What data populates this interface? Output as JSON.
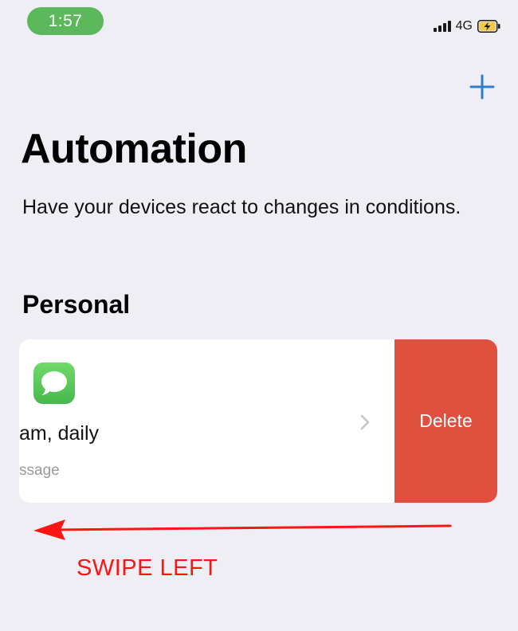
{
  "status_bar": {
    "time": "1:57",
    "network": "4G",
    "icons": [
      "signal-icon",
      "battery-charging-icon"
    ]
  },
  "header": {
    "add_icon": "plus-icon"
  },
  "main": {
    "title": "Automation",
    "subtitle": "Have your devices react to changes in conditions.",
    "section_title": "Personal"
  },
  "automation_row": {
    "icon": "messages-app-icon",
    "title": "am, daily",
    "subtitle": "ssage",
    "chevron_icon": "chevron-right-icon",
    "delete_label": "Delete"
  },
  "annotation": {
    "label": "SWIPE LEFT",
    "arrow_icon": "arrow-left-icon"
  },
  "colors": {
    "background": "#efeef4",
    "accent": "#2f7dd1",
    "time_pill": "#5cb95b",
    "delete": "#e14f3f",
    "annotation": "#ff1414"
  }
}
